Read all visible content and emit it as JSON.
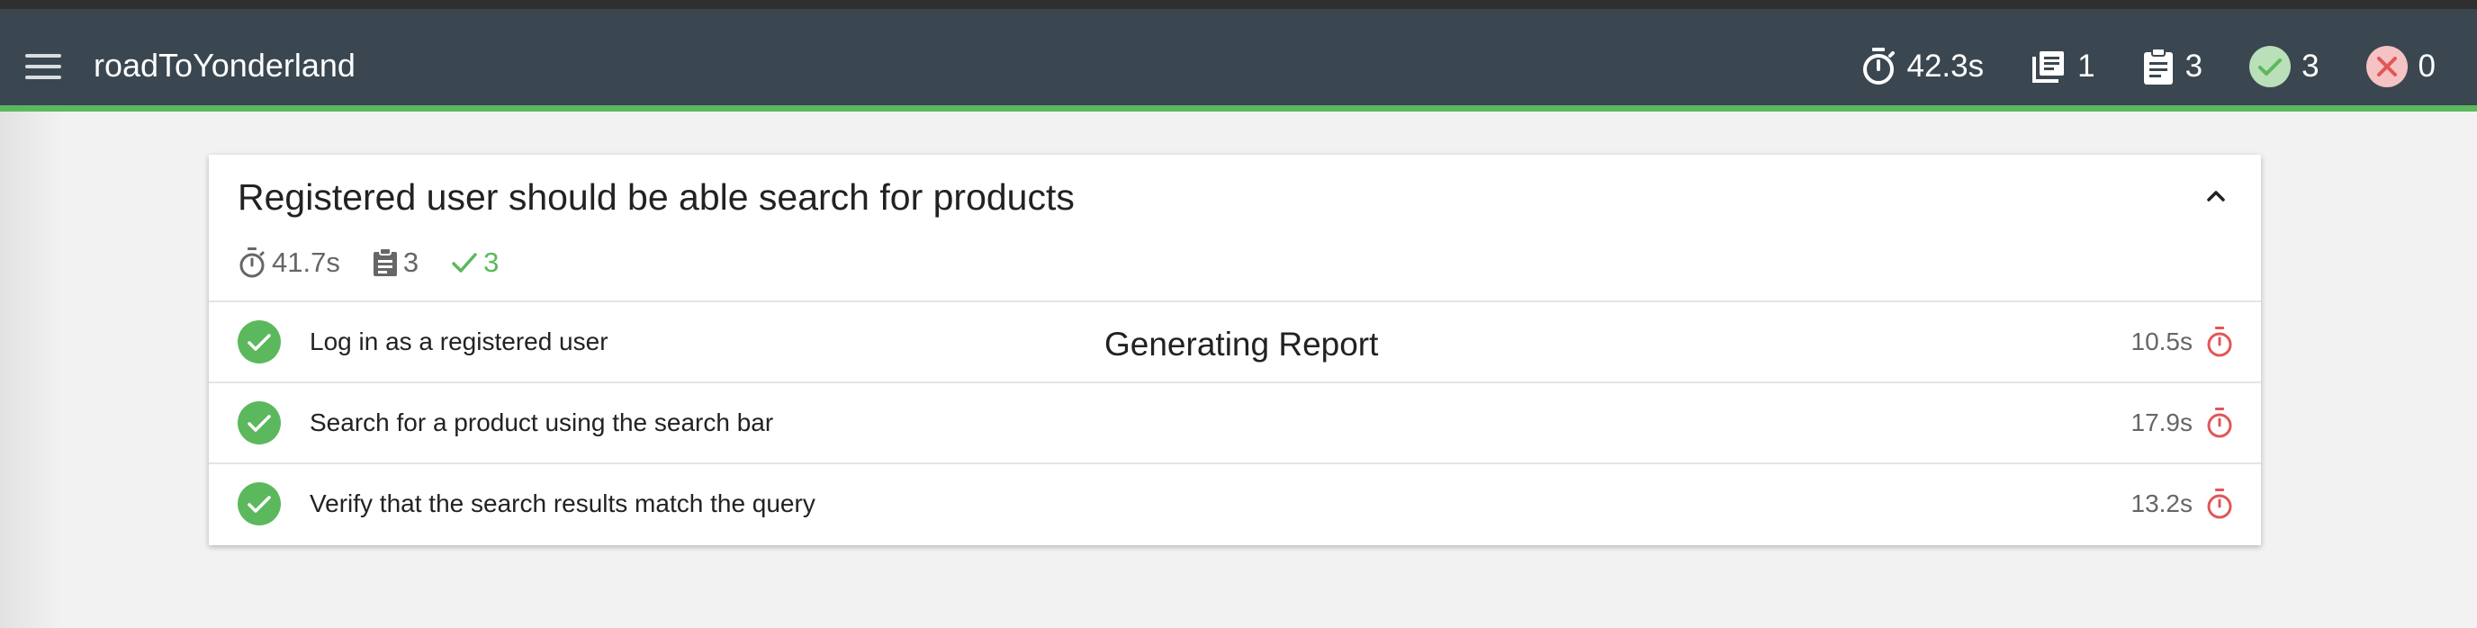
{
  "app": {
    "title": "roadToYonderland"
  },
  "header_stats": {
    "duration": "42.3s",
    "features": "1",
    "scenarios": "3",
    "passed": "3",
    "failed": "0"
  },
  "feature_card": {
    "title": "Registered user should be able search for products",
    "duration": "41.7s",
    "scenarios": "3",
    "passed": "3",
    "steps": [
      {
        "label": "Log in as a registered user",
        "duration": "10.5s"
      },
      {
        "label": "Search for a product using the search bar",
        "duration": "17.9s"
      },
      {
        "label": "Verify that the search results match the query",
        "duration": "13.2s"
      }
    ]
  },
  "overlay": {
    "text": "Generating Report"
  },
  "colors": {
    "appbar": "#3a4750",
    "accent_green": "#5cb85c",
    "fail_red": "#e05757",
    "timer_red": "#e05757"
  }
}
